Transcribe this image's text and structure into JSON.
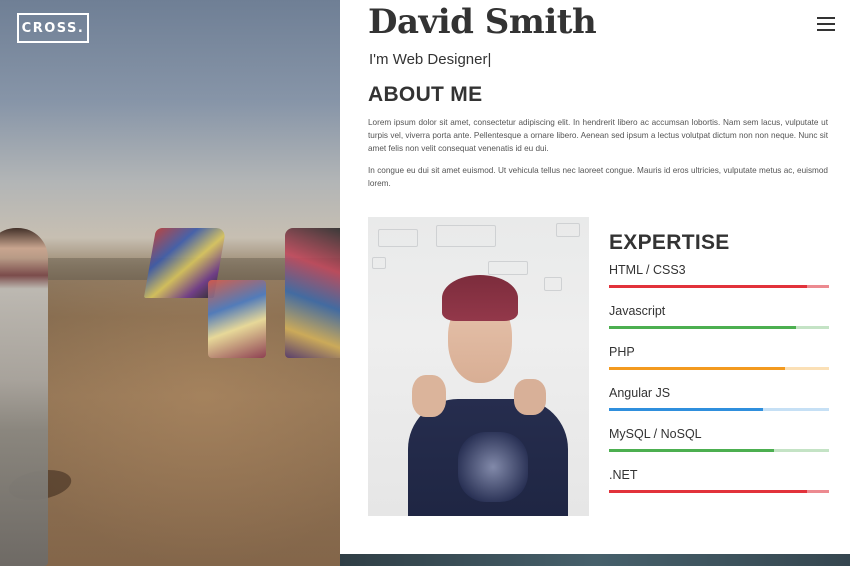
{
  "brand": {
    "logo_text": "CROSS."
  },
  "header": {
    "name": "David Smith",
    "tagline": "I'm Web Designer|",
    "menu_icon": "hamburger-menu-icon"
  },
  "about": {
    "title": "ABOUT ME",
    "paragraphs": [
      "Lorem ipsum dolor sit amet, consectetur adipiscing elit. In hendrerit libero ac accumsan lobortis. Nam sem lacus, vulputate ut turpis vel, viverra porta ante. Pellentesque a ornare libero. Aenean sed ipsum a lectus volutpat dictum non non neque. Nunc sit amet felis non velit consequat venenatis id eu dui.",
      "In congue eu dui sit amet euismod. Ut vehicula tellus nec laoreet congue. Mauris id eros ultricies, vulputate metus ac, euismod lorem."
    ]
  },
  "expertise": {
    "title": "EXPERTISE",
    "skills": [
      {
        "label": "HTML / CSS3",
        "level": 0.9,
        "color": "#e2323b",
        "track": "#ec8a90"
      },
      {
        "label": "Javascript",
        "level": 0.85,
        "color": "#4caf50",
        "track": "#c4e3c5"
      },
      {
        "label": "PHP",
        "level": 0.8,
        "color": "#f39a1f",
        "track": "#fbe0b6"
      },
      {
        "label": "Angular JS",
        "level": 0.7,
        "color": "#2f8fdd",
        "track": "#c6e0f5"
      },
      {
        "label": "MySQL / NoSQL",
        "level": 0.75,
        "color": "#4caf50",
        "track": "#c4e3c5"
      },
      {
        "label": ".NET",
        "level": 0.9,
        "color": "#e2323b",
        "track": "#ec8a90"
      }
    ]
  }
}
